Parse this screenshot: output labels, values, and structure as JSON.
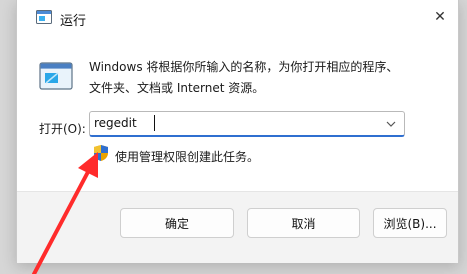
{
  "window": {
    "title": "运行",
    "close_label": "✕"
  },
  "description": {
    "line1": "Windows 将根据你所输入的名称，为你打开相应的程序、",
    "line2": "文件夹、文档或 Internet 资源。"
  },
  "open": {
    "label": "打开(O):",
    "value": "regedit"
  },
  "admin_note": "使用管理权限创建此任务。",
  "buttons": {
    "ok": "确定",
    "cancel": "取消",
    "browse": "浏览(B)..."
  },
  "colors": {
    "accent": "#2f6fd0",
    "annotation_arrow": "#ff2b2b"
  },
  "icons": {
    "app": "run-app-icon",
    "content": "run-window-icon",
    "close": "close-icon",
    "dropdown": "chevron-down-icon",
    "shield": "uac-shield-icon"
  }
}
